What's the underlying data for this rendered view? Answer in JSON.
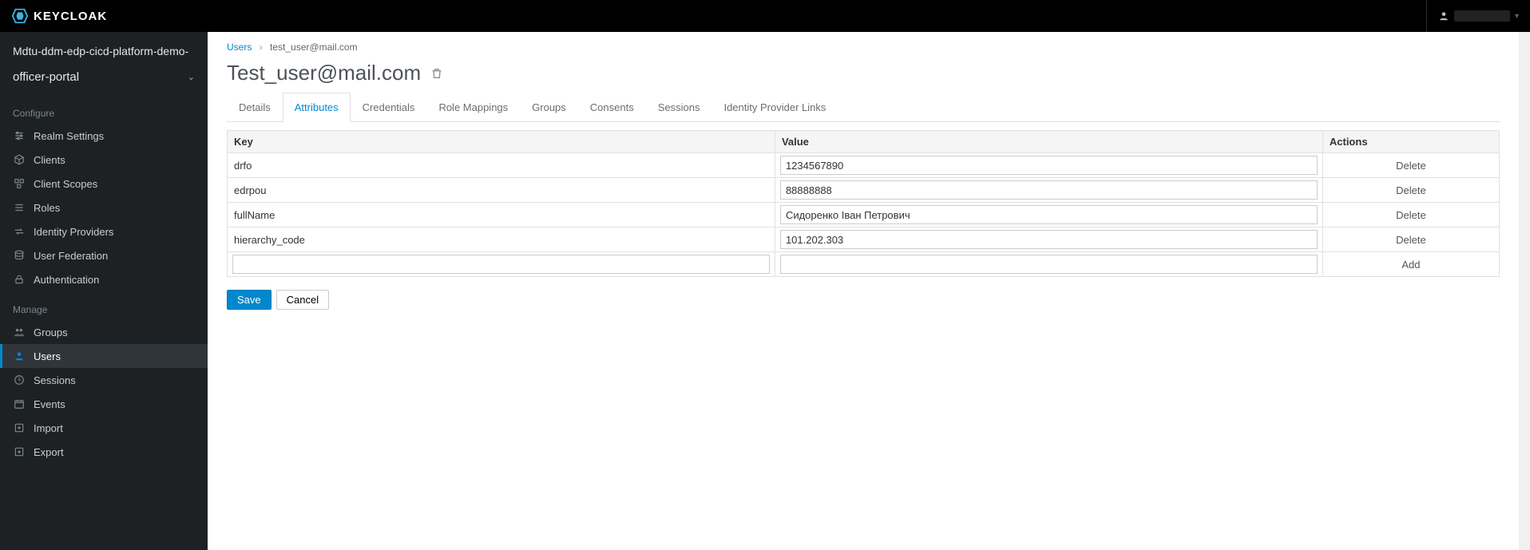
{
  "brand": {
    "name": "KEYCLOAK"
  },
  "current_user": {
    "display": ""
  },
  "realm": {
    "long_name": "Mdtu-ddm-edp-cicd-platform-demo-",
    "short_name": "officer-portal"
  },
  "sidebar": {
    "sections": [
      {
        "title": "Configure",
        "items": [
          {
            "icon": "sliders-icon",
            "label": "Realm Settings"
          },
          {
            "icon": "cube-icon",
            "label": "Clients"
          },
          {
            "icon": "cubes-icon",
            "label": "Client Scopes"
          },
          {
            "icon": "list-icon",
            "label": "Roles"
          },
          {
            "icon": "exchange-icon",
            "label": "Identity Providers"
          },
          {
            "icon": "database-icon",
            "label": "User Federation"
          },
          {
            "icon": "lock-icon",
            "label": "Authentication"
          }
        ]
      },
      {
        "title": "Manage",
        "items": [
          {
            "icon": "users-icon",
            "label": "Groups"
          },
          {
            "icon": "user-icon",
            "label": "Users",
            "active": true
          },
          {
            "icon": "clock-icon",
            "label": "Sessions"
          },
          {
            "icon": "calendar-icon",
            "label": "Events"
          },
          {
            "icon": "import-icon",
            "label": "Import"
          },
          {
            "icon": "export-icon",
            "label": "Export"
          }
        ]
      }
    ]
  },
  "breadcrumb": {
    "root": "Users",
    "current": "test_user@mail.com"
  },
  "page": {
    "title": "Test_user@mail.com"
  },
  "tabs": [
    {
      "label": "Details"
    },
    {
      "label": "Attributes",
      "active": true
    },
    {
      "label": "Credentials"
    },
    {
      "label": "Role Mappings"
    },
    {
      "label": "Groups"
    },
    {
      "label": "Consents"
    },
    {
      "label": "Sessions"
    },
    {
      "label": "Identity Provider Links"
    }
  ],
  "table": {
    "headers": {
      "key": "Key",
      "value": "Value",
      "actions": "Actions"
    },
    "rows": [
      {
        "key": "drfo",
        "value": "1234567890",
        "action": "Delete"
      },
      {
        "key": "edrpou",
        "value": "88888888",
        "action": "Delete"
      },
      {
        "key": "fullName",
        "value": "Сидоренко Іван Петрович",
        "action": "Delete"
      },
      {
        "key": "hierarchy_code",
        "value": "101.202.303",
        "action": "Delete"
      }
    ],
    "new_row": {
      "key": "",
      "value": "",
      "action": "Add"
    }
  },
  "buttons": {
    "save": "Save",
    "cancel": "Cancel"
  }
}
